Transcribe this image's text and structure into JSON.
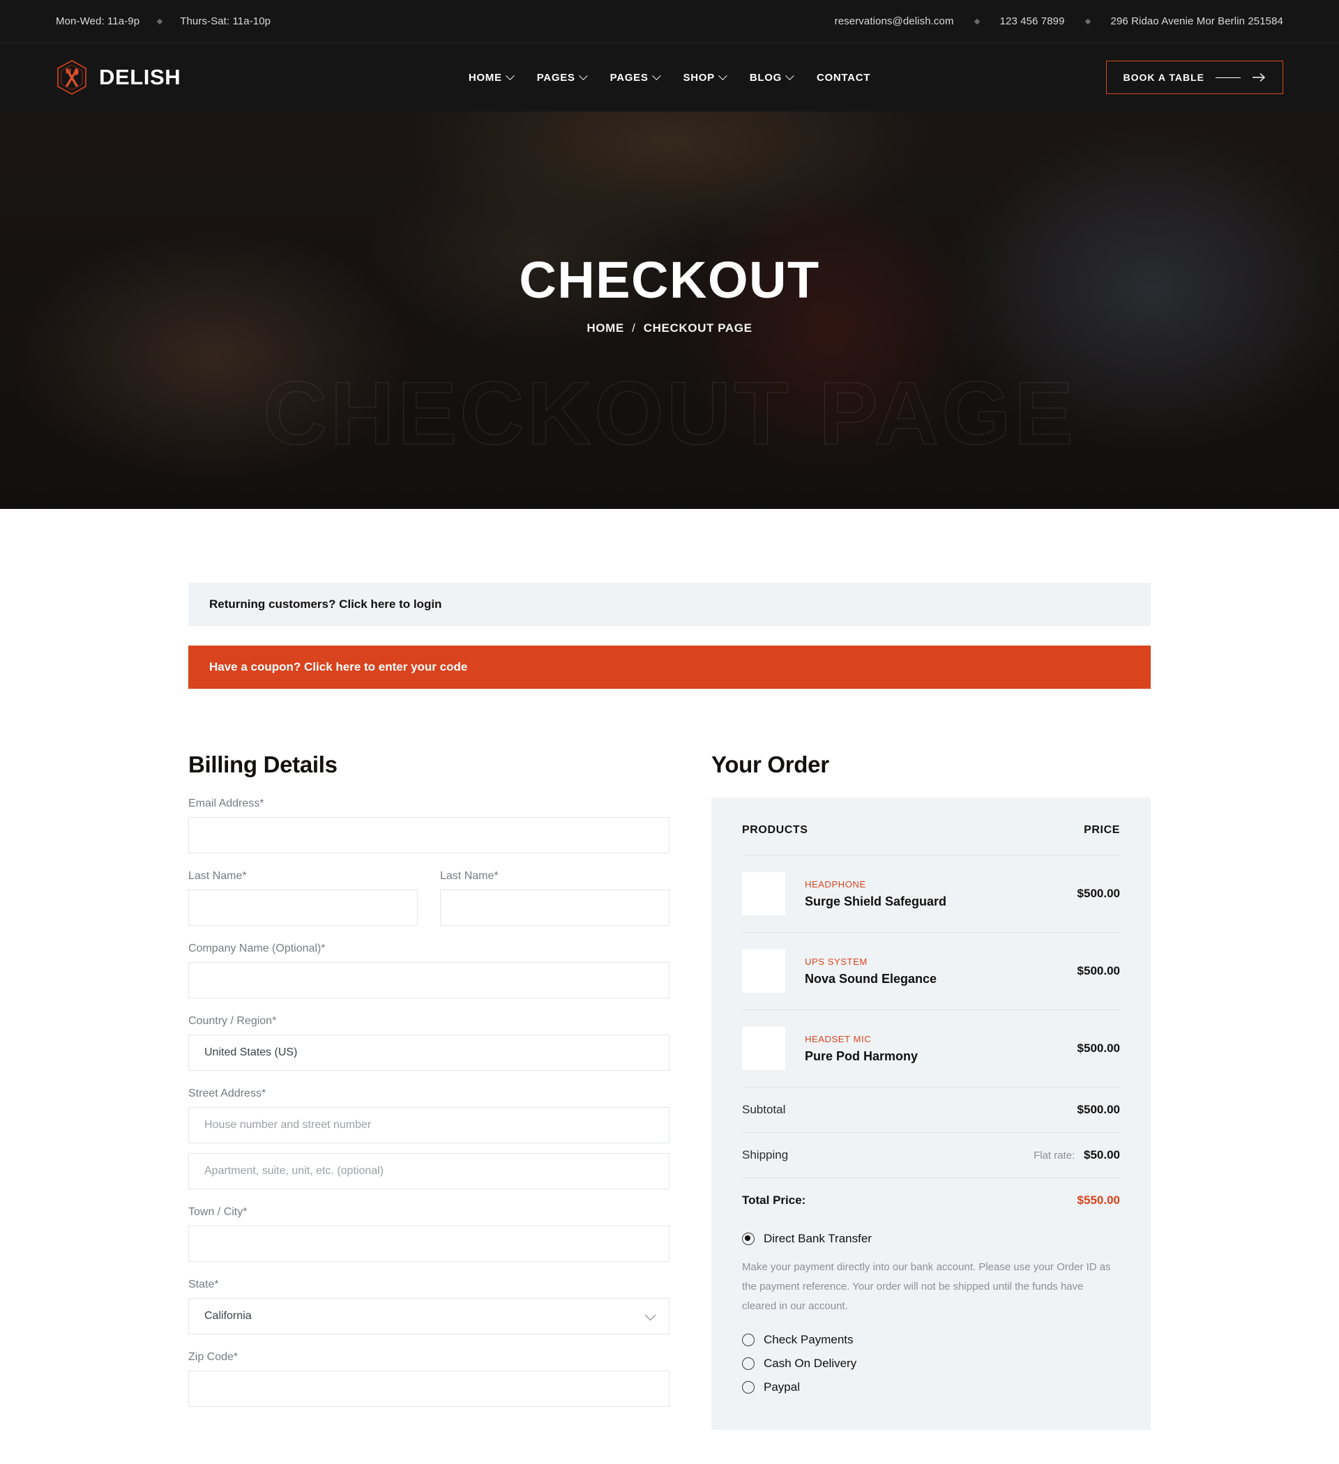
{
  "topbar": {
    "hours_1": "Mon-Wed: 11a-9p",
    "hours_2": "Thurs-Sat: 11a-10p",
    "email": "reservations@delish.com",
    "phone": "123 456 7899",
    "address": "296 Ridao Avenie Mor Berlin 251584"
  },
  "header": {
    "brand": "DELISH",
    "brand_icon": "fork-knife-hexagon-logo",
    "nav": [
      {
        "label": "HOME",
        "has_caret": true
      },
      {
        "label": "PAGES",
        "has_caret": true
      },
      {
        "label": "PAGES",
        "has_caret": true
      },
      {
        "label": "SHOP",
        "has_caret": true
      },
      {
        "label": "BLOG",
        "has_caret": true
      },
      {
        "label": "CONTACT",
        "has_caret": false
      }
    ],
    "cta": "BOOK A TABLE",
    "cta_icon": "arrow-right-icon"
  },
  "hero": {
    "title": "CHECKOUT",
    "watermark": "CHECKOUT PAGE",
    "breadcrumb_home": "HOME",
    "breadcrumb_sep": "/",
    "breadcrumb_current": "CHECKOUT PAGE"
  },
  "notices": {
    "login": "Returning customers? Click here to login",
    "coupon": "Have a coupon? Click here to enter your code"
  },
  "billing": {
    "title": "Billing Details",
    "email_label": "Email Address*",
    "email_value": "",
    "first_name_label": "Last Name*",
    "first_name_value": "",
    "last_name_label": "Last Name*",
    "last_name_value": "",
    "company_label": "Company Name (Optional)*",
    "company_value": "",
    "country_label": "Country / Region*",
    "country_value": "United States (US)",
    "street_label": "Street Address*",
    "street_placeholder": "House number and street number",
    "street_value": "",
    "apartment_placeholder": "Apartment, suite, unit, etc. (optional)",
    "apartment_value": "",
    "city_label": "Town / City*",
    "city_value": "",
    "state_label": "State*",
    "state_value": "California",
    "state_chevron": "chevron-down-icon",
    "zip_label": "Zip Code*",
    "zip_value": ""
  },
  "order": {
    "title": "Your Order",
    "col_products": "PRODUCTS",
    "col_price": "PRICE",
    "items": [
      {
        "category": "HEADPHONE",
        "name": "Surge Shield Safeguard",
        "price": "$500.00"
      },
      {
        "category": "UPS SYSTEM",
        "name": "Nova Sound Elegance",
        "price": "$500.00"
      },
      {
        "category": "HEADSET MIC",
        "name": "Pure Pod Harmony",
        "price": "$500.00"
      }
    ],
    "subtotal_label": "Subtotal",
    "subtotal_value": "$500.00",
    "shipping_label": "Shipping",
    "shipping_note": "Flat rate:",
    "shipping_value": "$50.00",
    "total_label": "Total Price:",
    "total_value": "$550.00",
    "payment": {
      "selected": "Direct Bank Transfer",
      "bank_label": "Direct Bank Transfer",
      "bank_desc": "Make your payment directly into our bank account. Please use your Order ID as the payment reference. Your order will not be shipped until the funds have cleared in our account.",
      "check_label": "Check Payments",
      "cod_label": "Cash On Delivery",
      "paypal_label": "Paypal"
    }
  },
  "colors": {
    "accent": "#d9431d",
    "dark": "#151515",
    "panel": "#f0f3f5"
  }
}
